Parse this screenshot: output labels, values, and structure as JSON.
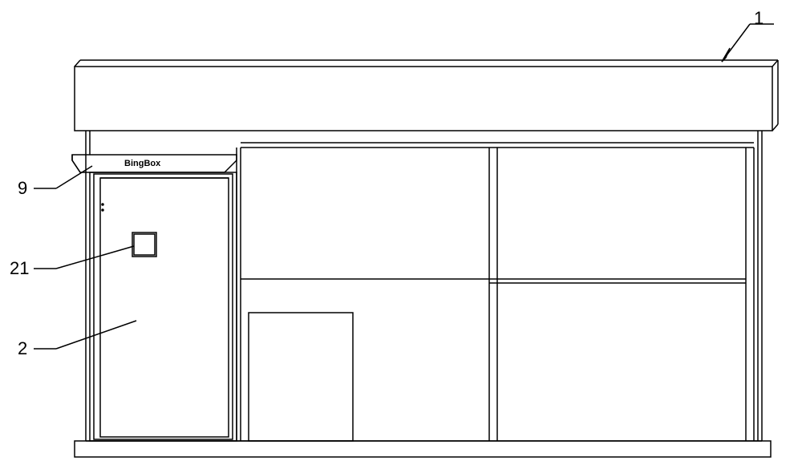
{
  "labels": {
    "ref1": "1",
    "ref2": "2",
    "ref9": "9",
    "ref21": "21"
  },
  "brand": "BingBox"
}
